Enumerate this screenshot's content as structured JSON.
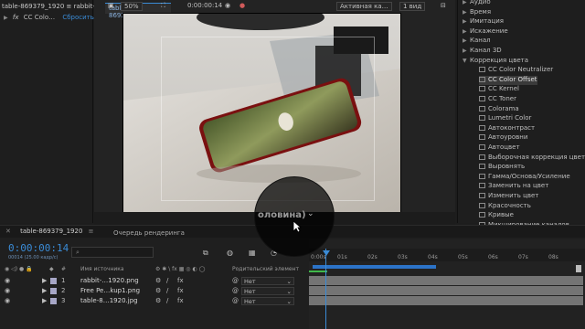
{
  "effect_controls": {
    "tab_label": "table-869379_1920 ≡ rabbit-2…",
    "layer_name": "CC Colo…",
    "fx_symbol": "fx",
    "reset_label": "Сбросить"
  },
  "composition": {
    "tab_label": "table-869379_1920"
  },
  "viewer_footer": {
    "zoom": "50%",
    "timecode": "0:00:00:14",
    "ring_text": "оловина)",
    "camera": "Активная ка…",
    "views": "1 вид"
  },
  "effects_presets": {
    "items": [
      {
        "label": "Аудио",
        "level": 0,
        "open": false
      },
      {
        "label": "Время",
        "level": 0,
        "open": false
      },
      {
        "label": "Имитация",
        "level": 0,
        "open": false
      },
      {
        "label": "Искажение",
        "level": 0,
        "open": false
      },
      {
        "label": "Канал",
        "level": 0,
        "open": false
      },
      {
        "label": "Канал 3D",
        "level": 0,
        "open": false
      },
      {
        "label": "Коррекция цвета",
        "level": 0,
        "open": true
      },
      {
        "label": "CC Color Neutralizer",
        "level": 1
      },
      {
        "label": "CC Color Offset",
        "level": 1,
        "selected": true
      },
      {
        "label": "CC Kernel",
        "level": 1
      },
      {
        "label": "CC Toner",
        "level": 1
      },
      {
        "label": "Colorama",
        "level": 1
      },
      {
        "label": "Lumetri Color",
        "level": 1
      },
      {
        "label": "Автоконтраст",
        "level": 1
      },
      {
        "label": "Автоуровни",
        "level": 1
      },
      {
        "label": "Автоцвет",
        "level": 1
      },
      {
        "label": "Выборочная коррекция цвета",
        "level": 1
      },
      {
        "label": "Выровнять",
        "level": 1
      },
      {
        "label": "Гамма/Основа/Усиление",
        "level": 1
      },
      {
        "label": "Заменить на цвет",
        "level": 1
      },
      {
        "label": "Изменить цвет",
        "level": 1
      },
      {
        "label": "Красочность",
        "level": 1
      },
      {
        "label": "Кривые",
        "level": 1
      },
      {
        "label": "Микширование каналов",
        "level": 1
      }
    ]
  },
  "timeline": {
    "tab_label": "table-869379_1920",
    "render_queue_label": "Очередь рендеринга",
    "timecode": "0:00:00:14",
    "fps": "00014 (25.00 кадр/с)",
    "search_placeholder": "",
    "col_source": "Имя источника",
    "col_parent": "Родительский элемент",
    "ruler_ticks": [
      "0:00s",
      "01s",
      "02s",
      "03s",
      "04s",
      "05s",
      "06s",
      "07s",
      "08s"
    ],
    "layers": [
      {
        "num": "1",
        "name": "rabbit-…1920.png",
        "parent": "Нет",
        "color": "#a7a7c7"
      },
      {
        "num": "2",
        "name": "Free Pe…kup1.png",
        "parent": "Нет",
        "color": "#a7a7c7"
      },
      {
        "num": "3",
        "name": "table-8…1920.jpg",
        "parent": "Нет",
        "color": "#a7a7c7"
      }
    ]
  }
}
